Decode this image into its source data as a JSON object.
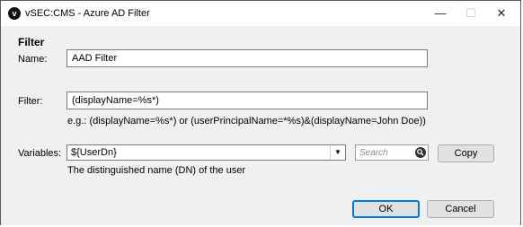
{
  "window": {
    "title": "vSEC:CMS - Azure AD Filter",
    "icon_letter": "v"
  },
  "controls": {
    "minimize": "—",
    "maximize": "☐",
    "close": "✕"
  },
  "section_title": "Filter",
  "name": {
    "label": "Name:",
    "value": "AAD Filter"
  },
  "filter": {
    "label": "Filter:",
    "value": "(displayName=%s*)",
    "hint": "e.g.: (displayName=%s*) or (userPrincipalName=*%s)&(displayName=John Doe))"
  },
  "variables": {
    "label": "Variables:",
    "selected": "${UserDn}",
    "description": "The distinguished name (DN) of the user",
    "search_placeholder": "Search",
    "copy_label": "Copy"
  },
  "buttons": {
    "ok": "OK",
    "cancel": "Cancel"
  }
}
